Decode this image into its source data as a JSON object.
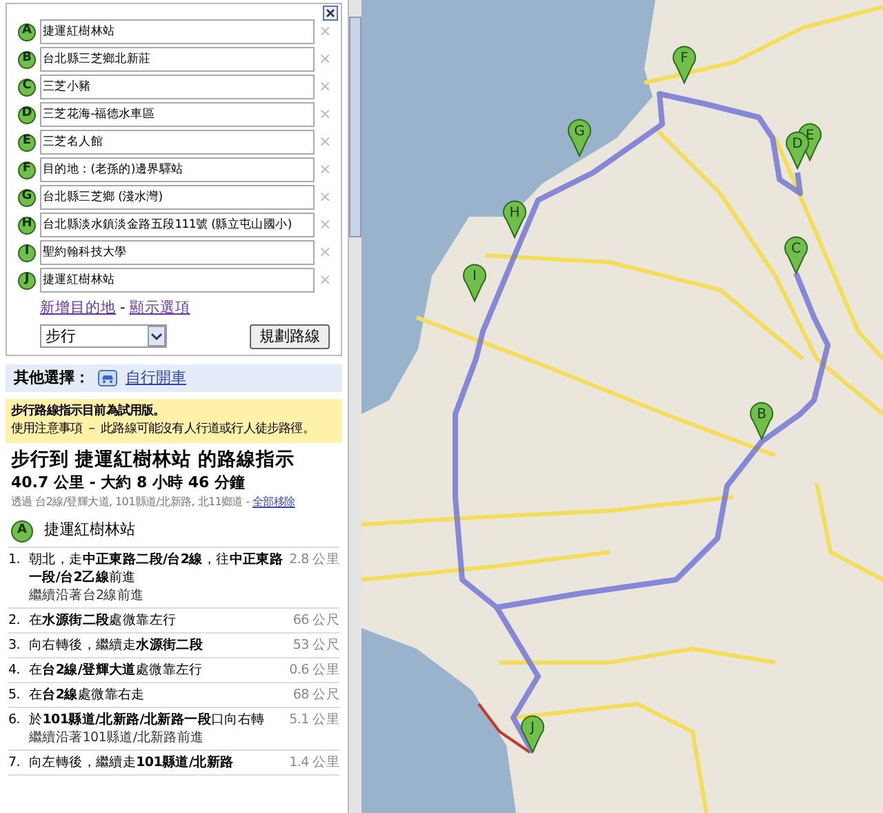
{
  "waypoints": [
    {
      "letter": "A",
      "value": "捷運紅樹林站"
    },
    {
      "letter": "B",
      "value": "台北縣三芝鄉北新莊"
    },
    {
      "letter": "C",
      "value": "三芝小豬"
    },
    {
      "letter": "D",
      "value": "三芝花海-福德水車區"
    },
    {
      "letter": "E",
      "value": "三芝名人館"
    },
    {
      "letter": "F",
      "value": "目的地：(老孫的)邊界驛站"
    },
    {
      "letter": "G",
      "value": "台北縣三芝鄉 (淺水灣)"
    },
    {
      "letter": "H",
      "value": "台北縣淡水鎮淡金路五段111號 (縣立屯山國小)"
    },
    {
      "letter": "I",
      "value": "聖約翰科技大學"
    },
    {
      "letter": "J",
      "value": "捷運紅樹林站"
    }
  ],
  "remove_mark": "×",
  "links": [
    "新增目的地",
    "顯示選項"
  ],
  "link_separator": "-",
  "travel_mode": "步行",
  "route_button": "規劃路線",
  "other_options": {
    "label": "其他選擇：",
    "link": "自行開車"
  },
  "notice": {
    "title": "步行路線指示目前為試用版。",
    "text": "使用注意事項 － 此路線可能沒有人行道或行人徒步路徑。"
  },
  "directions": {
    "title": "步行到 捷運紅樹林站 的路線指示",
    "summary": "40.7 公里 - 大約 8 小時 46 分鐘",
    "via": "透過 台2線/登輝大道, 101縣道/北新路, 北11鄉道 - ",
    "via_link": "全部移除",
    "start": {
      "letter": "A",
      "name": "捷運紅樹林站"
    }
  },
  "steps": [
    {
      "number": "1.",
      "text": "朝北，走**中正東路二段/台2線**，往**中正東路一段/台2乙線**前進",
      "note": "繼續沿著台2線前進",
      "distance": "2.8 公里"
    },
    {
      "number": "2.",
      "text": "在**水源街二段**處微靠左行",
      "distance": "66 公尺"
    },
    {
      "number": "3.",
      "text": "向右轉後，繼續走**水源街二段**",
      "distance": "53 公尺"
    },
    {
      "number": "4.",
      "text": "在**台2線/登輝大道**處微靠左行",
      "distance": "0.6 公里"
    },
    {
      "number": "5.",
      "text": "在**台2線**處微靠右走",
      "distance": "68 公尺"
    },
    {
      "number": "6.",
      "text": "於**101縣道/北新路/北新路一段**口向右轉",
      "note": "繼續沿著101縣道/北新路前進",
      "distance": "5.1 公里"
    },
    {
      "number": "7.",
      "text": "向左轉後，繼續走**101縣道/北新路**",
      "distance": "1.4 公里"
    }
  ],
  "map": {
    "markers": [
      {
        "label": "F"
      },
      {
        "label": "G"
      },
      {
        "label": "E"
      },
      {
        "label": "D"
      },
      {
        "label": "H"
      },
      {
        "label": "C"
      },
      {
        "label": "I"
      },
      {
        "label": "B"
      },
      {
        "label": "J"
      }
    ]
  }
}
